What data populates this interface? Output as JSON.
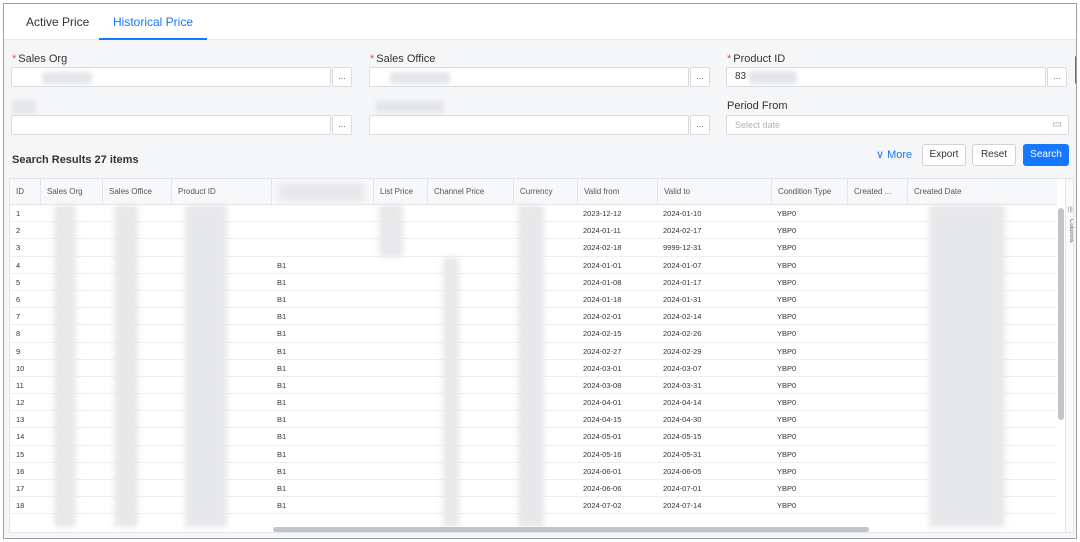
{
  "tabs": [
    {
      "label": "Active Price",
      "active": false
    },
    {
      "label": "Historical Price",
      "active": true
    }
  ],
  "form": {
    "sales_org_label": "Sales Org",
    "sales_office_label": "Sales Office",
    "product_id_label": "Product ID",
    "product_id_value": "83",
    "period_from_label": "Period From",
    "period_from_placeholder": "Select date",
    "ellipsis": "...",
    "required_mark": "*",
    "calendar_glyph": "▭"
  },
  "toolbar": {
    "results_label": "Search Results 27 items",
    "more_label": "∨ More",
    "export_label": "Export",
    "reset_label": "Reset",
    "search_label": "Search"
  },
  "table": {
    "headers": [
      "ID",
      "Sales Org",
      "Sales Office",
      "Product ID",
      "",
      "List Price",
      "Channel Price",
      "Currency",
      "Valid from",
      "Valid to",
      "Condition Type",
      "Created ...",
      "Created Date"
    ],
    "rows": [
      {
        "id": "1",
        "code": "",
        "from": "2023-12-12",
        "to": "2024-01-10",
        "cond": "YBP0"
      },
      {
        "id": "2",
        "code": "",
        "from": "2024-01-11",
        "to": "2024-02-17",
        "cond": "YBP0"
      },
      {
        "id": "3",
        "code": "",
        "from": "2024-02-18",
        "to": "9999-12-31",
        "cond": "YBP0"
      },
      {
        "id": "4",
        "code": "B1",
        "from": "2024-01-01",
        "to": "2024-01-07",
        "cond": "YBP0"
      },
      {
        "id": "5",
        "code": "B1",
        "from": "2024-01-08",
        "to": "2024-01-17",
        "cond": "YBP0"
      },
      {
        "id": "6",
        "code": "B1",
        "from": "2024-01-18",
        "to": "2024-01-31",
        "cond": "YBP0"
      },
      {
        "id": "7",
        "code": "B1",
        "from": "2024-02-01",
        "to": "2024-02-14",
        "cond": "YBP0"
      },
      {
        "id": "8",
        "code": "B1",
        "from": "2024-02-15",
        "to": "2024-02-26",
        "cond": "YBP0"
      },
      {
        "id": "9",
        "code": "B1",
        "from": "2024-02-27",
        "to": "2024-02-29",
        "cond": "YBP0"
      },
      {
        "id": "10",
        "code": "B1",
        "from": "2024-03-01",
        "to": "2024-03-07",
        "cond": "YBP0"
      },
      {
        "id": "11",
        "code": "B1",
        "from": "2024-03-08",
        "to": "2024-03-31",
        "cond": "YBP0"
      },
      {
        "id": "12",
        "code": "B1",
        "from": "2024-04-01",
        "to": "2024-04-14",
        "cond": "YBP0"
      },
      {
        "id": "13",
        "code": "B1",
        "from": "2024-04-15",
        "to": "2024-04-30",
        "cond": "YBP0"
      },
      {
        "id": "14",
        "code": "B1",
        "from": "2024-05-01",
        "to": "2024-05-15",
        "cond": "YBP0"
      },
      {
        "id": "15",
        "code": "B1",
        "from": "2024-05-16",
        "to": "2024-05-31",
        "cond": "YBP0"
      },
      {
        "id": "16",
        "code": "B1",
        "from": "2024-06-01",
        "to": "2024-06-05",
        "cond": "YBP0"
      },
      {
        "id": "17",
        "code": "B1",
        "from": "2024-06-06",
        "to": "2024-07-01",
        "cond": "YBP0"
      },
      {
        "id": "18",
        "code": "B1",
        "from": "2024-07-02",
        "to": "2024-07-14",
        "cond": "YBP0"
      }
    ],
    "columns_panel_label": "Columns",
    "columns_panel_icon": "|||"
  },
  "colors": {
    "accent": "#1677ff",
    "required": "#e34d59"
  }
}
